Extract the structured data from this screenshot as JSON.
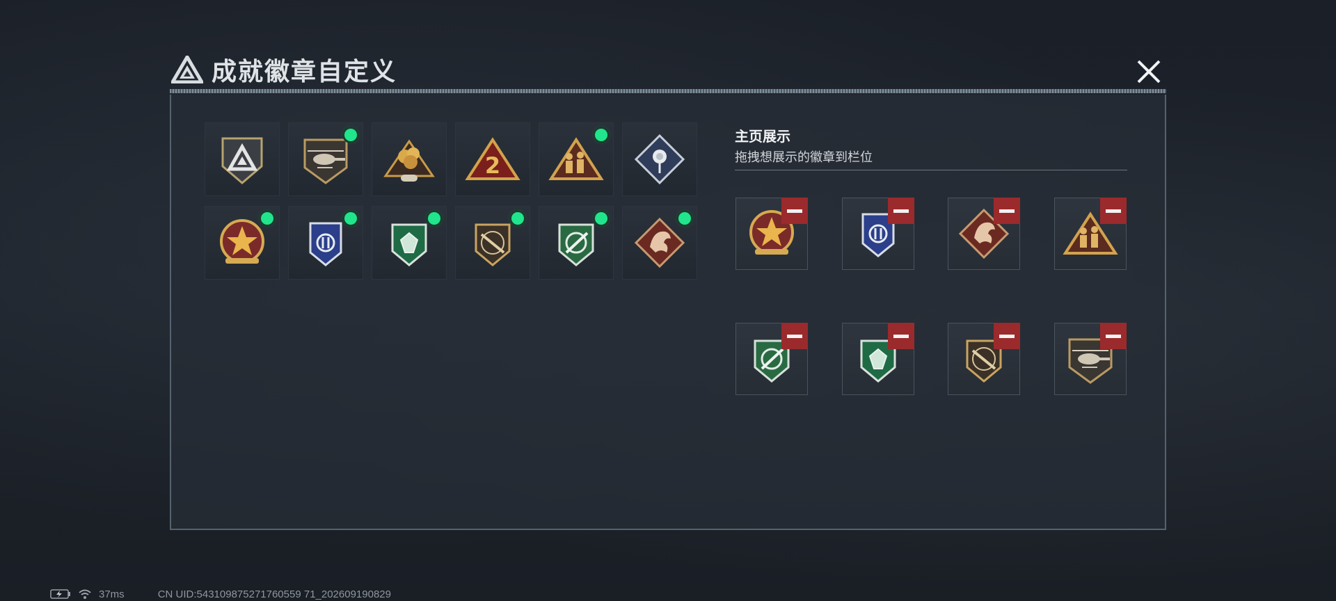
{
  "dialog": {
    "title": "成就徽章自定义",
    "close_icon": "close-icon"
  },
  "colors": {
    "status_dot": "#20e58c",
    "remove_button": "#9b2a2c",
    "panel_border": "#56626e"
  },
  "available_badges": [
    {
      "name": "triangle-shield-badge",
      "equipped": false
    },
    {
      "name": "helicopter-badge",
      "equipped": true
    },
    {
      "name": "explosion-badge",
      "equipped": false
    },
    {
      "name": "number-two-badge",
      "equipped": false
    },
    {
      "name": "soldiers-badge",
      "equipped": true
    },
    {
      "name": "rose-badge",
      "equipped": false
    },
    {
      "name": "star-medal-badge",
      "equipped": true
    },
    {
      "name": "blue-wing-badge",
      "equipped": true
    },
    {
      "name": "green-gem-badge",
      "equipped": true
    },
    {
      "name": "rifle-badge",
      "equipped": true
    },
    {
      "name": "knife-badge",
      "equipped": true
    },
    {
      "name": "dragon-badge",
      "equipped": true
    }
  ],
  "homepage_display": {
    "title": "主页展示",
    "subtitle": "拖拽想展示的徽章到栏位",
    "slots": [
      {
        "badge": "star-medal-badge"
      },
      {
        "badge": "blue-wing-badge"
      },
      {
        "badge": "dragon-badge"
      },
      {
        "badge": "soldiers-badge"
      },
      {
        "badge": "knife-badge"
      },
      {
        "badge": "green-gem-badge"
      },
      {
        "badge": "rifle-badge"
      },
      {
        "badge": "helicopter-badge"
      }
    ]
  },
  "footer": {
    "battery_icon": "battery-charging-icon",
    "wifi_icon": "wifi-icon",
    "ping": "37ms",
    "uid": "CN UID:543109875271760559 71_202609190829"
  }
}
